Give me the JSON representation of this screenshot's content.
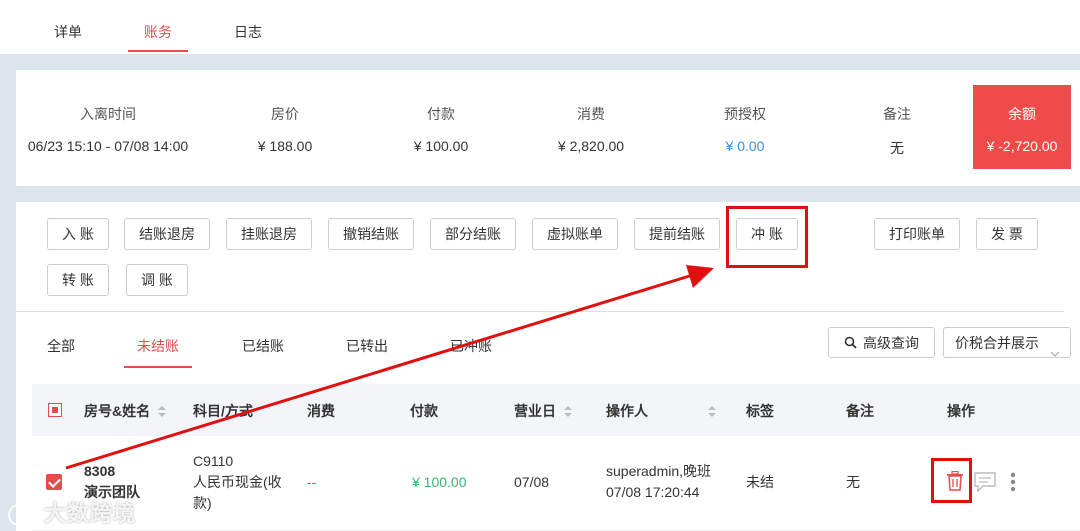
{
  "tabs": [
    {
      "label": "详单",
      "active": false
    },
    {
      "label": "账务",
      "active": true
    },
    {
      "label": "日志",
      "active": false
    }
  ],
  "summary": {
    "checkin": {
      "label": "入离时间",
      "value": "06/23 15:10 - 07/08 14:00"
    },
    "room_price": {
      "label": "房价",
      "value": "¥  188.00"
    },
    "payment": {
      "label": "付款",
      "value": "¥  100.00"
    },
    "consumption": {
      "label": "消费",
      "value": "¥  2,820.00"
    },
    "preauth": {
      "label": "预授权",
      "value": "¥  0.00"
    },
    "remark": {
      "label": "备注",
      "value": "无"
    },
    "balance": {
      "label": "余额",
      "value": "¥  -2,720.00"
    }
  },
  "actions": {
    "post": "入 账",
    "checkout_settle": "结账退房",
    "hang_checkout": "挂账退房",
    "cancel_settle": "撤销结账",
    "partial_settle": "部分结账",
    "virtual_bill": "虚拟账单",
    "early_settle": "提前结账",
    "reverse": "冲 账",
    "print_bill": "打印账单",
    "invoice": "发 票",
    "transfer": "转 账",
    "adjust": "调 账"
  },
  "filters": {
    "tabs": [
      "全部",
      "未结账",
      "已结账",
      "已转出",
      "已冲账"
    ],
    "active_index": 1,
    "advanced_search": "高级查询",
    "display_select": "价税合并展示"
  },
  "table": {
    "headers": [
      "房号&姓名",
      "科目/方式",
      "消费",
      "付款",
      "营业日",
      "操作人",
      "标签",
      "备注",
      "操作"
    ],
    "rows": [
      {
        "room": "8308",
        "name": "演示团队",
        "item_code": "C9110",
        "item_name_line1": "人民币现金(收",
        "item_name_line2": "款)",
        "consumption": "--",
        "payment": "¥ 100.00",
        "business_day": "07/08",
        "operator_line1": "superadmin,晚班",
        "operator_line2": "07/08 17:20:44",
        "tag": "未结",
        "remark": "无"
      }
    ]
  },
  "watermark": "大数跨境",
  "colors": {
    "accent": "#e54d4d",
    "balance_bg": "#ef4b4b",
    "payment_green": "#3cb371",
    "preauth_blue": "#3a8ee6",
    "annotation_red": "#e01010"
  }
}
